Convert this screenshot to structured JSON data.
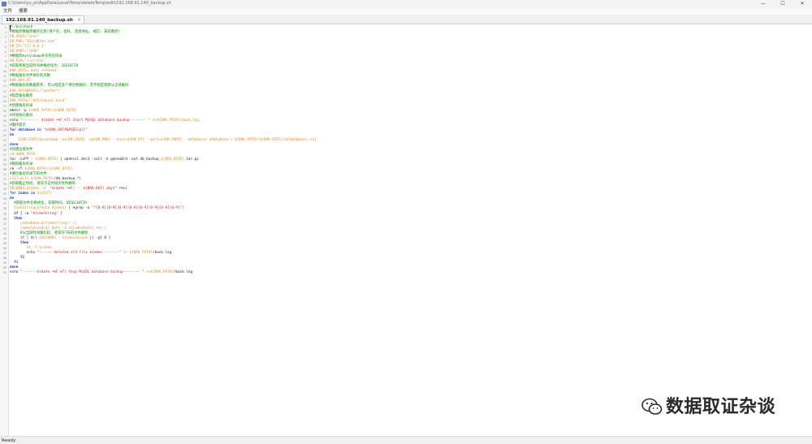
{
  "window": {
    "title": "C:\\Users\\yu_pt\\AppData\\Local\\Temp\\deleteTemp\\edit\\192.168.91.140_backup.sh",
    "controls": [
      "—",
      "☐",
      "✕"
    ]
  },
  "menu": {
    "items": [
      "文件",
      "搜索"
    ]
  },
  "tab": {
    "label": "192.168.91.140_backup.sh",
    "close": "×"
  },
  "status": {
    "text": "Ready"
  },
  "watermark": {
    "text": "数据取证杂谈"
  },
  "colors": {
    "comment": "#008a00",
    "variable": "#d58a2a",
    "string": "#c21f1f",
    "keyword": "#1d3fb8"
  },
  "code": {
    "line_numbers": [
      "1",
      "2",
      "3",
      "4",
      "5",
      "6",
      "7",
      "8",
      "9",
      "10",
      "11",
      "12",
      "13",
      "14",
      "15",
      "16",
      "17",
      "18",
      "19",
      "20",
      "21",
      "22",
      "23",
      "24",
      "25",
      "26",
      "27",
      "28",
      "29",
      "30",
      "31",
      "32",
      "33",
      "34",
      "35",
      "36",
      "37",
      "38",
      "39",
      "40",
      "41",
      "42",
      "43",
      "44",
      "45",
      "46",
      "47",
      "48",
      "49",
      "50",
      "51"
    ],
    "lines": [
      [
        {
          "t": "#!/bin/bash",
          "k": "comment"
        }
      ],
      [
        {
          "t": "#数据库数据库缓存信息(用户名, 密码, 连接地址, 端口, 安装路径)",
          "k": "comment"
        }
      ],
      [
        {
          "t": "DB_USER=\"root\"",
          "k": "var"
        }
      ],
      [
        {
          "t": "DB_PWD=\"3Sojm0fen.com\"",
          "k": "var"
        }
      ],
      [
        {
          "t": "DB_IP=\"127.0.0.1\"",
          "k": "var"
        }
      ],
      [
        {
          "t": "DB_PORT=\"3306\"",
          "k": "var"
        }
      ],
      [
        {
          "t": "#数据库mysqldump命令所在目录",
          "k": "comment"
        }
      ],
      [
        {
          "t": "DB_DIR=\"/usr/bin\"",
          "k": "var"
        }
      ],
      [
        {
          "t": "#获取系统当前时间并格式化为: 20210729",
          "k": "comment"
        }
      ],
      [
        {
          "t": "BAK_DATE=`date +%Y%m%d`",
          "k": "var"
        }
      ],
      [
        {
          "t": "#数据备份文件保存的天数",
          "k": "comment"
        }
      ],
      [
        {
          "t": "BAK_DAY=45",
          "k": "var"
        }
      ],
      [
        {
          "t": "#数据备份的数据库库, 可以指定多个用空格隔开, 若不指定则默认全部备份",
          "k": "comment"
        }
      ],
      [
        {
          "t": "BAK_DATABASES=(\"pasfex\")",
          "k": "var"
        }
      ],
      [
        {
          "t": "#指定备份路径",
          "k": "comment"
        }
      ],
      [
        {
          "t": "BAK_PATH=\"/data/mysql_back\"",
          "k": "var"
        }
      ],
      [
        {
          "t": "#创建备份目录",
          "k": "comment"
        }
      ],
      [
        {
          "t": "mkdir -p ",
          "k": "plain"
        },
        {
          "t": "${BAK_PATH}/${BAK_DATE}",
          "k": "var"
        }
      ],
      [
        {
          "t": "#开始执行备份",
          "k": "comment"
        }
      ],
      [
        {
          "t": "echo ",
          "k": "plain"
        },
        {
          "t": "\"-------- $(date +%F_%T) Start MySQL database backup-------- \"",
          "k": "str"
        },
        {
          "t": " >>${BAK_PATH}/back.log",
          "k": "var"
        }
      ],
      [
        {
          "t": "#循环提示",
          "k": "comment"
        }
      ],
      [
        {
          "t": "for database in ",
          "k": "kw"
        },
        {
          "t": "\"${BAK_DATABASES[@]}\"",
          "k": "str"
        }
      ],
      [
        {
          "t": "do",
          "k": "kw"
        }
      ],
      [
        {
          "t": "    ${DB_DIR}/mysqldump -u${DB_USER} -p${DB_PWD} --host=${DB_IP} --port=${DB_PORT} --databases $database > ${BAK_PATH}/${BAK_DATE}/${database}.sql",
          "k": "var"
        }
      ],
      [
        {
          "t": "done",
          "k": "kw"
        }
      ],
      [
        {
          "t": "#创建压缩文件",
          "k": "comment"
        }
      ],
      [
        {
          "t": "cd $BAK_PATH",
          "k": "var"
        }
      ],
      [
        {
          "t": "tar -czPf - ",
          "k": "plain"
        },
        {
          "t": "${BAK_DATE}",
          "k": "var"
        },
        {
          "t": " | openssl des3 -salt -k p@ssw0rd -out db_backup_",
          "k": "plain"
        },
        {
          "t": "${BAK_DATE}",
          "k": "var"
        },
        {
          "t": ".tar.gz",
          "k": "plain"
        }
      ],
      [
        {
          "t": "#删除备份目录",
          "k": "comment"
        }
      ],
      [
        {
          "t": "rm -rf ",
          "k": "plain"
        },
        {
          "t": "${BAK_PATH}/${BAK_DATE}",
          "k": "var"
        }
      ],
      [
        {
          "t": "#遍历备份目录下的文件",
          "k": "comment"
        }
      ],
      [
        {
          "t": "LIST=$(ls ${BAK_PATH}",
          "k": "var"
        },
        {
          "t": "/db_backup_*)",
          "k": "plain"
        }
      ],
      [
        {
          "t": "#获取截止时间, 将早于这时间的文件删除",
          "k": "comment"
        }
      ],
      [
        {
          "t": "SECONDS=$(date -d  ",
          "k": "var"
        },
        {
          "t": "\"$(date +%F) -- ${BAK_DAY} days\"",
          "k": "str"
        },
        {
          "t": " +%s)",
          "k": "plain"
        }
      ],
      [
        {
          "t": "for index in ",
          "k": "kw"
        },
        {
          "t": "${LIST}",
          "k": "var"
        }
      ],
      [
        {
          "t": "do",
          "k": "kw"
        }
      ],
      [
        {
          "t": "  #获取文件名格式化, 获取时间, 如20210729",
          "k": "comment"
        }
      ],
      [
        {
          "t": "  timeString=$(echo $index)",
          "k": "var"
        },
        {
          "t": " | egrep -o ",
          "k": "plain"
        },
        {
          "t": "\"?[0-9][0-9][0-9][0-9][0-9][0-9][0-9][0-9]\")",
          "k": "str"
        }
      ],
      [
        {
          "t": "  if [ -n ",
          "k": "kw"
        },
        {
          "t": "\"$timeString\"",
          "k": "str"
        },
        {
          "t": " ]",
          "k": "plain"
        }
      ],
      [
        {
          "t": "  then",
          "k": "kw"
        }
      ],
      [
        {
          "t": "     indexDate=${timeString//./}",
          "k": "var"
        }
      ],
      [
        {
          "t": "     indexSecond=$( date -d ${indexDate} +%s )",
          "k": "var"
        }
      ],
      [
        {
          "t": "     #与当前时间做比较, 把早于7天的文件删除",
          "k": "comment"
        }
      ],
      [
        {
          "t": "     if [ $(( ",
          "k": "plain"
        },
        {
          "t": "$SECONDS - $indexSecond",
          "k": "var"
        },
        {
          "t": " )) -gt 0 ]",
          "k": "plain"
        }
      ],
      [
        {
          "t": "     then",
          "k": "kw"
        }
      ],
      [
        {
          "t": "        rm -f $index",
          "k": "var"
        }
      ],
      [
        {
          "t": "        echo ",
          "k": "plain"
        },
        {
          "t": "\"-------deleted old file $index -------\"",
          "k": "str"
        },
        {
          "t": " >> ${BAK_PATH}",
          "k": "var"
        },
        {
          "t": "/back.log",
          "k": "plain"
        }
      ],
      [
        {
          "t": "     fi",
          "k": "kw"
        }
      ],
      [
        {
          "t": "  fi",
          "k": "kw"
        }
      ],
      [
        {
          "t": "done",
          "k": "kw"
        }
      ],
      [
        {
          "t": "echo ",
          "k": "plain"
        },
        {
          "t": "\"-------$(date +%F_%T) Stop MySQL database backup-------- \"",
          "k": "str"
        },
        {
          "t": " >>${BAK_PATH}",
          "k": "var"
        },
        {
          "t": "/back.log",
          "k": "plain"
        }
      ]
    ]
  }
}
